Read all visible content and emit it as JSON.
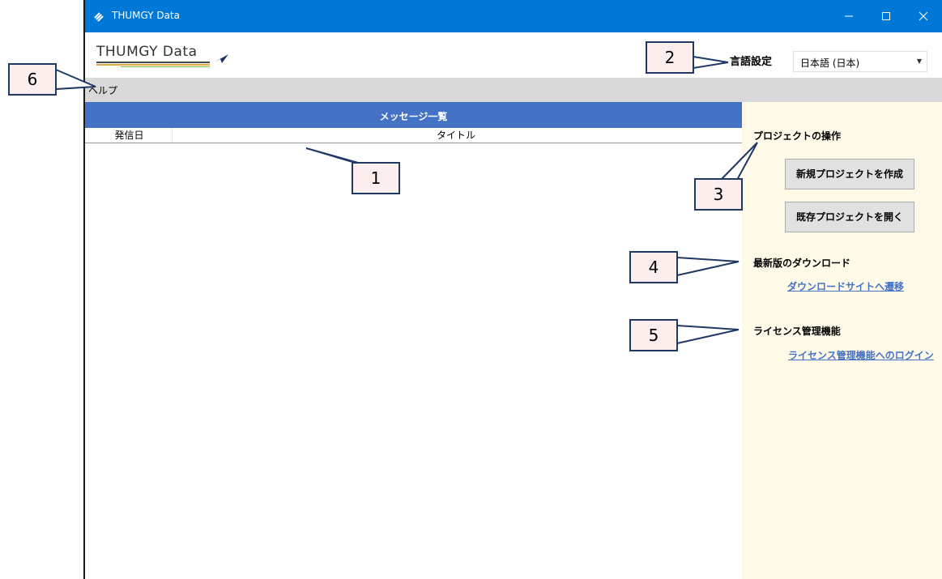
{
  "window": {
    "title": "THUMGY Data",
    "titlebar_color": "#0078d7",
    "controls": [
      "minimize-icon",
      "maximize-icon",
      "close-icon"
    ]
  },
  "header": {
    "logo_text": "THUMGY Data",
    "language_label": "言語設定",
    "language_value": "日本語 (日本)"
  },
  "menu": {
    "help_label": "ヘルプ"
  },
  "messages": {
    "panel_title": "メッセージ一覧",
    "header_color": "#4472c4",
    "columns": [
      "発信日",
      "タイトル"
    ],
    "rows": []
  },
  "side_panel": {
    "background": "#fff9e8",
    "project_section_title": "プロジェクトの操作",
    "new_project_button": "新規プロジェクトを作成",
    "open_project_button": "既存プロジェクトを開く",
    "download_section_title": "最新版のダウンロード",
    "download_link": "ダウンロードサイトへ遷移",
    "license_section_title": "ライセンス管理機能",
    "license_link": "ライセンス管理機能へのログイン"
  },
  "callouts": [
    "1",
    "2",
    "3",
    "4",
    "5",
    "6"
  ]
}
